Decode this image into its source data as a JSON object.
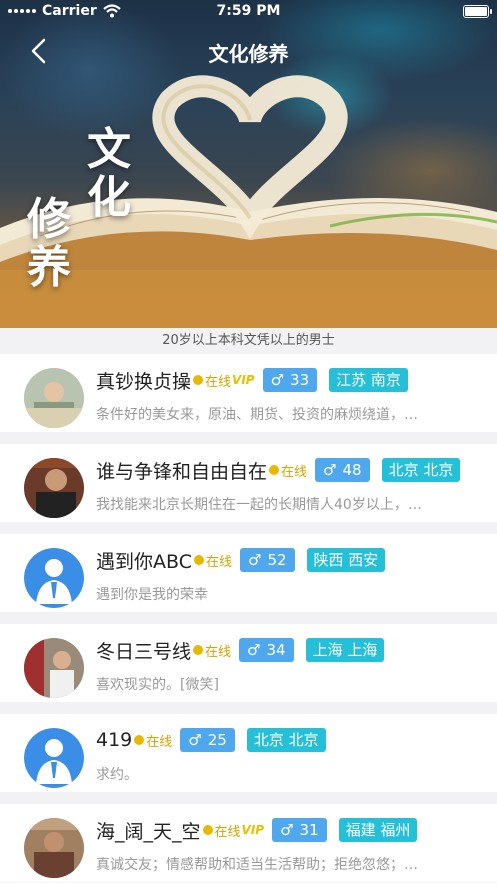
{
  "status": {
    "carrier": "Carrier",
    "time": "7:59 PM"
  },
  "nav": {
    "title": "文化修养"
  },
  "hero": {
    "line1": "文化",
    "line2": "修养"
  },
  "subtitle": "20岁以上本科文凭以上的男士",
  "online_label": "在线",
  "vip_label": "VIP",
  "gender_symbol": "♂",
  "users": [
    {
      "name": "真钞换贞操",
      "vip": true,
      "age": "33",
      "city": "江苏 南京",
      "desc": "条件好的美女来，原油、期货、投资的麻烦绕道，…"
    },
    {
      "name": "谁与争锋和自由自在",
      "vip": false,
      "age": "48",
      "city": "北京 北京",
      "desc": "我找能来北京长期住在一起的长期情人40岁以上，…"
    },
    {
      "name": "遇到你ABC",
      "vip": false,
      "age": "52",
      "city": "陕西 西安",
      "desc": "遇到你是我的荣幸"
    },
    {
      "name": "冬日三号线",
      "vip": false,
      "age": "34",
      "city": "上海 上海",
      "desc": "喜欢现实的。[微笑]"
    },
    {
      "name": "419",
      "vip": false,
      "age": "25",
      "city": "北京 北京",
      "desc": "求约。"
    },
    {
      "name": "海_阔_天_空",
      "vip": true,
      "age": "31",
      "city": "福建 福州",
      "desc": "真诚交友；情感帮助和适当生活帮助；拒绝忽悠；…"
    }
  ]
}
